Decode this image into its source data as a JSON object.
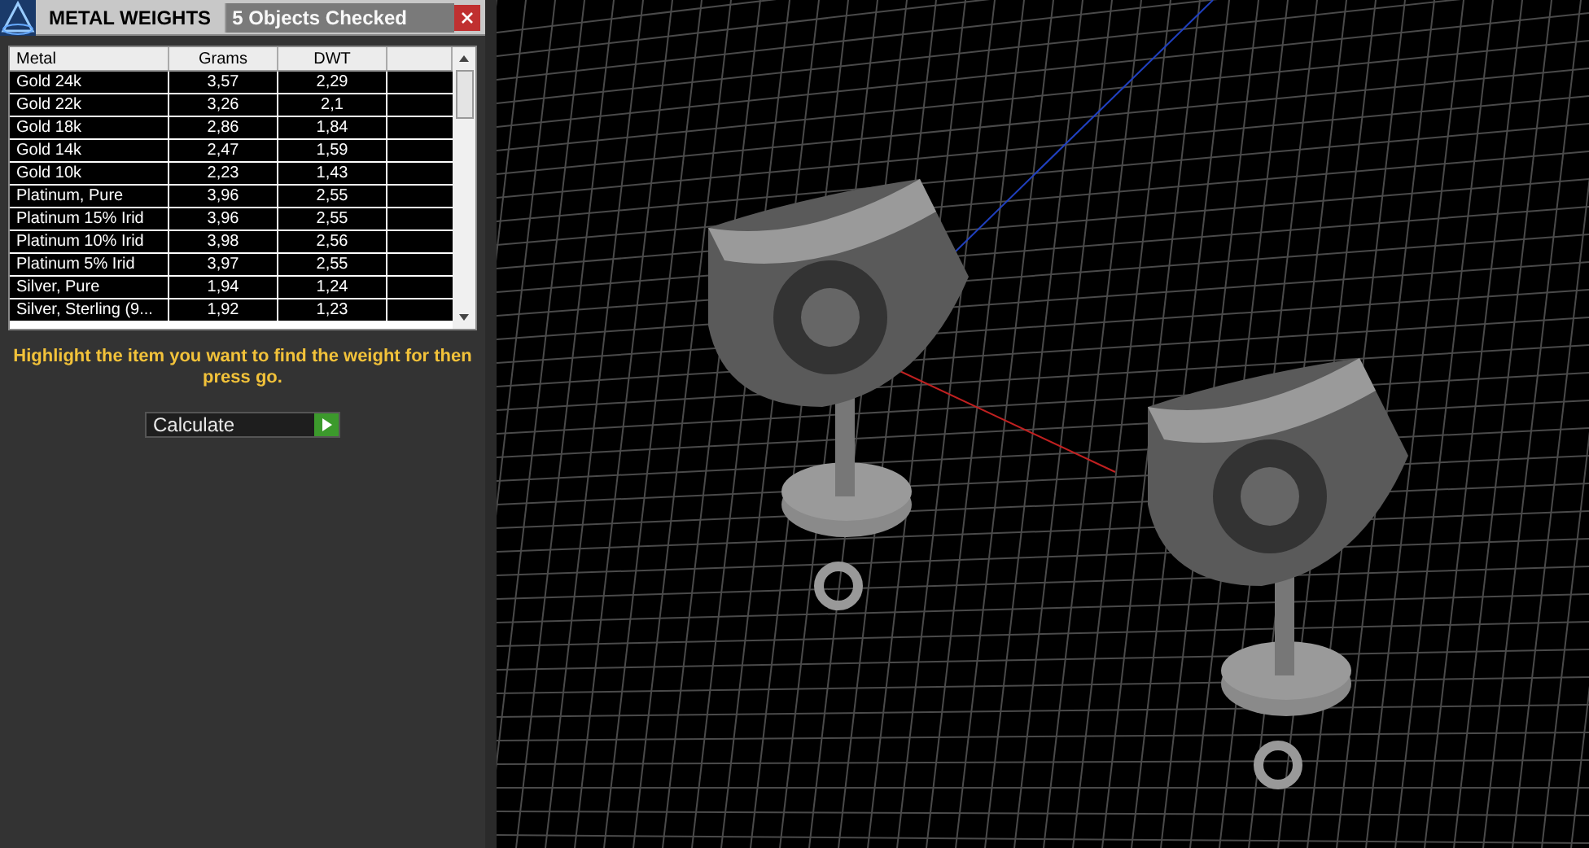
{
  "panel": {
    "title": "METAL WEIGHTS",
    "status": "5 Objects Checked"
  },
  "table": {
    "columns": [
      "Metal",
      "Grams",
      "DWT"
    ],
    "rows": [
      [
        "Gold 24k",
        "3,57",
        "2,29"
      ],
      [
        "Gold 22k",
        "3,26",
        "2,1"
      ],
      [
        "Gold 18k",
        "2,86",
        "1,84"
      ],
      [
        "Gold 14k",
        "2,47",
        "1,59"
      ],
      [
        "Gold 10k",
        "2,23",
        "1,43"
      ],
      [
        "Platinum, Pure",
        "3,96",
        "2,55"
      ],
      [
        "Platinum 15% Irid",
        "3,96",
        "2,55"
      ],
      [
        "Platinum 10% Irid",
        "3,98",
        "2,56"
      ],
      [
        "Platinum 5% Irid",
        "3,97",
        "2,55"
      ],
      [
        "Silver, Pure",
        "1,94",
        "1,24"
      ],
      [
        "Silver, Sterling (9...",
        "1,92",
        "1,23"
      ]
    ]
  },
  "instruction": "Highlight the item you want to find the weight for then press go.",
  "action": {
    "value": "Calculate"
  }
}
